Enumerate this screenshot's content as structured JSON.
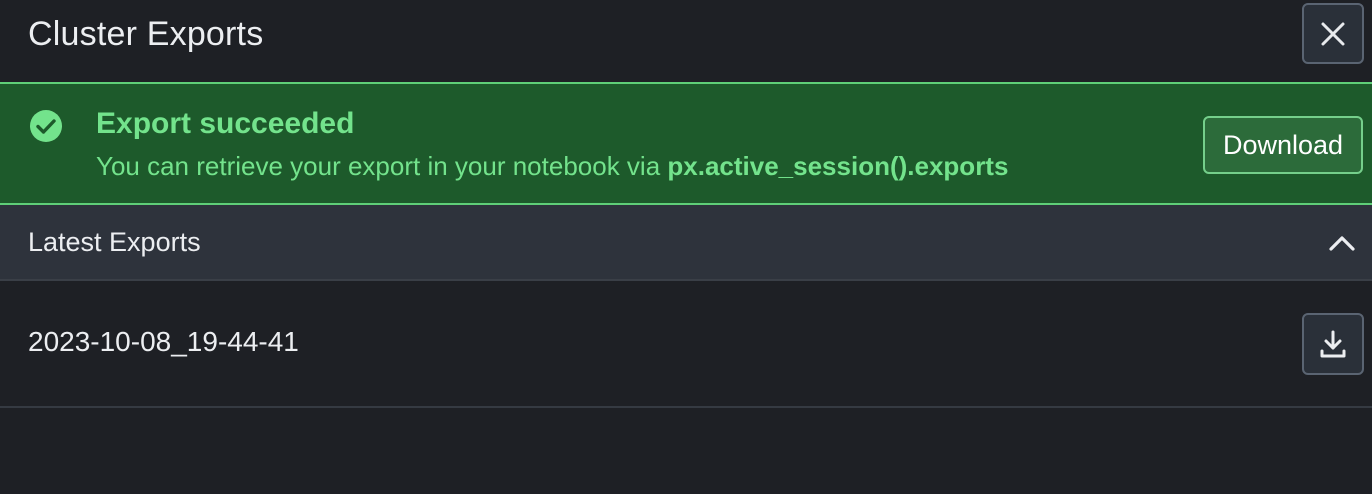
{
  "header": {
    "title": "Cluster Exports",
    "close_icon": "close-icon"
  },
  "banner": {
    "status_icon": "check-circle-icon",
    "title": "Export succeeded",
    "message_prefix": "You can retrieve your export in your notebook via ",
    "message_code": "px.active_session().exports",
    "download_label": "Download"
  },
  "latest_exports": {
    "title": "Latest Exports",
    "collapse_icon": "chevron-up-icon",
    "items": [
      {
        "name": "2023-10-08_19-44-41",
        "download_icon": "download-icon"
      }
    ]
  },
  "colors": {
    "background": "#1e2025",
    "banner_bg": "#1d5a2b",
    "banner_accent": "#73e38c",
    "section_bg": "#2e333c"
  }
}
